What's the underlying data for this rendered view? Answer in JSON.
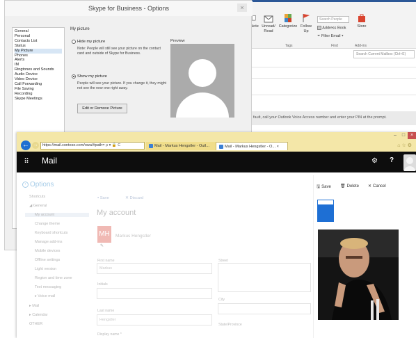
{
  "outlook": {
    "ribbon_items": [
      "Note",
      "Unread/ Read",
      "Categorize",
      "Follow Up",
      "Store"
    ],
    "search_people_placeholder": "Search People",
    "address_book": "Address Book",
    "filter_email": "Filter Email",
    "groups": [
      "Tags",
      "Find",
      "Add-ins"
    ],
    "mailbox_search_placeholder": "Search Current Mailbox (Ctrl+E)",
    "notice": "fault, call your Outlook Voice Access number and enter your PIN at the prompt."
  },
  "skype": {
    "title": "Skype for Business - Options",
    "close": "×",
    "nav": [
      "General",
      "Personal",
      "Contacts List",
      "Status",
      "My Picture",
      "Phones",
      "Alerts",
      "IM",
      "Ringtones and Sounds",
      "Audio Device",
      "Video Device",
      "Call Forwarding",
      "File Saving",
      "Recording",
      "Skype Meetings"
    ],
    "selected_nav": "My Picture",
    "section_heading": "My picture",
    "hide_option": "Hide my picture",
    "hide_note": "Note: People will still see your picture on the contact card and outside of Skype for Business.",
    "show_option": "Show my picture",
    "show_note": "People will see your picture. If you change it, they might not see the new one right away.",
    "change_button": "Edit or Remove Picture",
    "preview_label": "Preview"
  },
  "browser": {
    "url": "https://mail.contoso.com/owa/#path=",
    "url_suffix": "ρ ▾ 🔒 C",
    "tabs": [
      "Mail - Markus Hengstler - Outl...",
      "Mail - Markus Hengstler - O... ×"
    ],
    "win_controls": [
      "–",
      "□",
      "×"
    ],
    "tool_icons": "⌂☆⚙"
  },
  "owa": {
    "app_title": "Mail",
    "options_title": "Options",
    "nav": [
      {
        "label": "Shortcuts",
        "type": "top"
      },
      {
        "label": "General",
        "type": "top",
        "prefix": "◢ "
      },
      {
        "label": "My account",
        "type": "sub",
        "selected": true
      },
      {
        "label": "Change theme",
        "type": "sub"
      },
      {
        "label": "Keyboard shortcuts",
        "type": "sub"
      },
      {
        "label": "Manage add-ins",
        "type": "sub"
      },
      {
        "label": "Mobile devices",
        "type": "sub"
      },
      {
        "label": "Offline settings",
        "type": "sub"
      },
      {
        "label": "Light version",
        "type": "sub"
      },
      {
        "label": "Region and time zone",
        "type": "sub"
      },
      {
        "label": "Text messaging",
        "type": "sub"
      },
      {
        "label": "Voice mail",
        "type": "sub",
        "prefix": "▸ "
      },
      {
        "label": "Mail",
        "type": "top",
        "prefix": "▸ "
      },
      {
        "label": "Calendar",
        "type": "top",
        "prefix": "▸ "
      },
      {
        "label": "OTHER",
        "type": "top"
      }
    ],
    "toolbar_save": "Save",
    "toolbar_discard": "Discard",
    "account_title": "My account",
    "initials": "MH",
    "display_name": "Markus Hengstler",
    "fields": {
      "first_name_label": "First name",
      "first_name_value": "Markus",
      "initials_label": "Initials",
      "last_name_label": "Last name",
      "last_name_value": "Hengstler",
      "display_name_label": "Display name *",
      "street_label": "Street",
      "city_label": "City",
      "state_label": "State/Province"
    },
    "photo_panel": {
      "save": "Save",
      "delete": "Delete",
      "cancel": "Cancel"
    }
  },
  "colors": {
    "owa_header": "#0d0d0d",
    "browser_chrome": "#f4e7a8",
    "owa_accent": "#1e6fd4",
    "skype_preview": "#ababab"
  }
}
